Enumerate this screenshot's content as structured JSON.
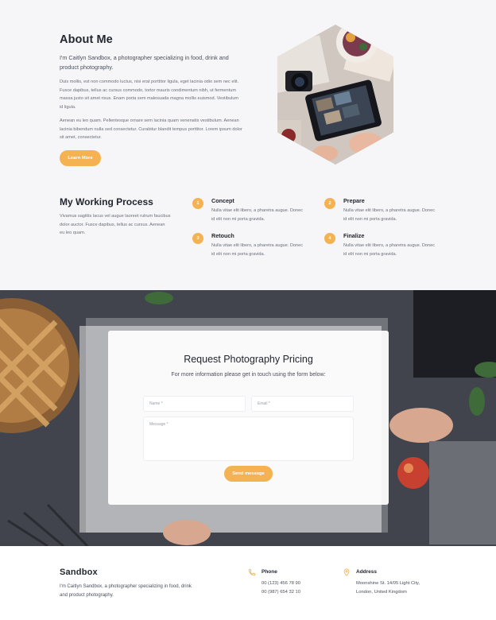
{
  "about": {
    "heading": "About Me",
    "lead": "I'm Caitlyn Sandbox, a photographer specializing in food, drink and product photography.",
    "paragraph1": "Duis mollis, est non commodo luctus, nisi erat porttitor ligula, eget lacinia odio sem nec elit. Fusce dapibus, tellus ac cursus commodo, tortor mauris condimentum nibh, ut fermentum massa justo sit amet risus. Enam porta sem malesuada magna mollis euismod. Vestibulum id ligula.",
    "paragraph2": "Aenean eu leo quam. Pellentesque ornare sem lacinia quam venenatis vestibulum. Aenean lacinia bibendum nulla sed consectetur. Curabitur blandit tempus porttitor. Lorem ipsum dolor sit amet, consectetur.",
    "button_label": "Learn More"
  },
  "process": {
    "heading": "My Working Process",
    "description": "Vivamus sagittis lacus vel augue laoreet rutrum faucibus dolor auctor. Fusce dapibus, tellus ac cursus. Aenean eu leo quam.",
    "steps": [
      {
        "number": "1",
        "title": "Concept",
        "text": "Nulla vitae elit libero, a pharetra augue. Donec id elit non mi porta gravida."
      },
      {
        "number": "2",
        "title": "Prepare",
        "text": "Nulla vitae elit libero, a pharetra augue. Donec id elit non mi porta gravida."
      },
      {
        "number": "3",
        "title": "Retouch",
        "text": "Nulla vitae elit libero, a pharetra augue. Donec id elit non mi porta gravida."
      },
      {
        "number": "4",
        "title": "Finalize",
        "text": "Nulla vitae elit libero, a pharetra augue. Donec id elit non mi porta gravida."
      }
    ]
  },
  "contact": {
    "title": "Request Photography Pricing",
    "subtitle": "For more information please get in touch using the form below:",
    "name_placeholder": "Name *",
    "email_placeholder": "Email *",
    "message_placeholder": "Message *",
    "send_label": "Send message"
  },
  "footer": {
    "brand": "Sandbox",
    "brand_desc": "I'm Caitlyn Sandbox, a photographer specializing in food, drink and product photography.",
    "phone_title": "Phone",
    "phone_1": "00 (123) 456 78 90",
    "phone_2": "00 (987) 654 32 10",
    "address_title": "Address",
    "address_1": "Moonshine St. 14/05 Light City,",
    "address_2": "London, United Kingdom"
  },
  "colors": {
    "accent": "#f5b252",
    "heading": "#22262f",
    "background": "#f6f6f8"
  },
  "icons": {
    "phone": "phone-icon",
    "address": "map-pin-icon"
  }
}
